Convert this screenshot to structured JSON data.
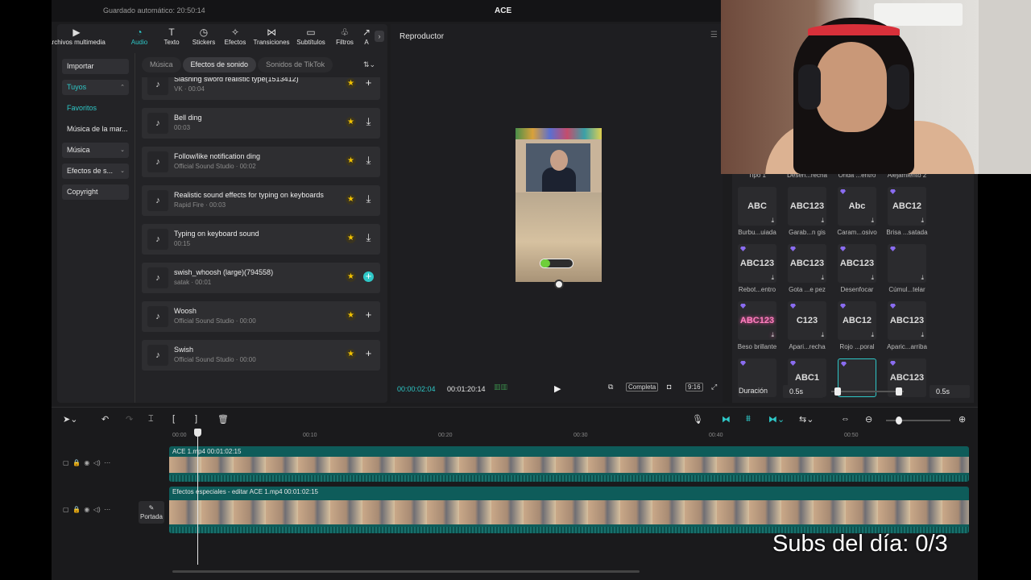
{
  "titlebar": {
    "autosave": "Guardado automático: 20:50:14",
    "project_name": "ACE"
  },
  "tabs": [
    {
      "label": "Archivos multimedia",
      "icon": "media-icon",
      "glyph": "▶"
    },
    {
      "label": "Audio",
      "icon": "audio-icon",
      "glyph": "◔"
    },
    {
      "label": "Texto",
      "icon": "text-icon",
      "glyph": "T"
    },
    {
      "label": "Stickers",
      "icon": "sticker-icon",
      "glyph": "◷"
    },
    {
      "label": "Efectos",
      "icon": "effects-icon",
      "glyph": "✧"
    },
    {
      "label": "Transiciones",
      "icon": "transition-icon",
      "glyph": "⋈"
    },
    {
      "label": "Subtítulos",
      "icon": "subtitle-icon",
      "glyph": "▭"
    },
    {
      "label": "Filtros",
      "icon": "filter-icon",
      "glyph": "♧"
    },
    {
      "label": "A",
      "icon": "adjust-icon",
      "glyph": "↗"
    }
  ],
  "side_nav": {
    "importar": "Importar",
    "tuyos": "Tuyos",
    "favoritos": "Favoritos",
    "musica_marca": "Música de la mar...",
    "musica": "Música",
    "efectos": "Efectos de s...",
    "copyright": "Copyright"
  },
  "sub_tabs": {
    "musica": "Música",
    "efectos": "Efectos de sonido",
    "tiktok": "Sonidos de TikTok"
  },
  "sounds": [
    {
      "title": "Slashing sword realistic type(1513412)",
      "meta": "VK · 00:04"
    },
    {
      "title": "Bell ding",
      "meta": "00:03"
    },
    {
      "title": "Follow/like notification ding",
      "meta": "Official Sound Studio · 00:02"
    },
    {
      "title": "Realistic sound effects for typing on keyboards",
      "meta": "Rapid Fire · 00:03"
    },
    {
      "title": "Typing on keyboard sound",
      "meta": "00:15"
    },
    {
      "title": "swish_whoosh (large)(794558)",
      "meta": "satak · 00:01"
    },
    {
      "title": "Woosh",
      "meta": "Official Sound Studio · 00:00"
    },
    {
      "title": "Swish",
      "meta": "Official Sound Studio · 00:00"
    }
  ],
  "player": {
    "title": "Reproductor",
    "current_time": "00:00:02:04",
    "total_time": "00:01:20:14",
    "completa": "Completa",
    "ratio": "9:16",
    "progress_fraction": 0.3
  },
  "text_styles": {
    "top_labels": [
      "Tipo 1",
      "Desen...recha",
      "Onda ...entro",
      "Alejamiento 2"
    ],
    "tiles": [
      {
        "text": "ABC",
        "label": "Burbu...uiada"
      },
      {
        "text": "ABC123",
        "label": "Garab...n gis"
      },
      {
        "text": "Abc",
        "label": "Caram...osivo"
      },
      {
        "text": "ABC12",
        "label": "Brisa ...satada"
      },
      {
        "text": "ABC123",
        "label": "Rebot...entro"
      },
      {
        "text": "ABC123",
        "label": "Gota ...e pez"
      },
      {
        "text": "ABC123",
        "label": "Desenfocar"
      },
      {
        "text": "",
        "label": "Cúmul...telar"
      },
      {
        "text": "ABC123",
        "label": "Beso brillante"
      },
      {
        "text": "C123",
        "label": "Apari...recha"
      },
      {
        "text": "ABC12",
        "label": "Rojo ...poral"
      },
      {
        "text": "ABC123",
        "label": "Aparic...arriba"
      },
      {
        "text": "",
        "label": ""
      },
      {
        "text": "ABC1",
        "label": ""
      },
      {
        "text": "",
        "label": ""
      },
      {
        "text": "ABC123",
        "label": ""
      }
    ],
    "duration_label": "Duración",
    "duration_in": "0.5s",
    "duration_out": "0.5s"
  },
  "timeline": {
    "ruler": [
      "00:00",
      "00:10",
      "00:20",
      "00:30",
      "00:40",
      "00:50"
    ],
    "clip1_label": "ACE 1.mp4   00:01:02:15",
    "clip2_label": "Efectos especiales - editar   ACE 1.mp4   00:01:02:15",
    "portada": "Portada"
  },
  "overlay": {
    "subs": "Subs del día: 0/3"
  },
  "colors": {
    "accent": "#2ec7c7",
    "star": "#f2c200",
    "panel": "#232326",
    "clip": "#0e5c5a"
  }
}
